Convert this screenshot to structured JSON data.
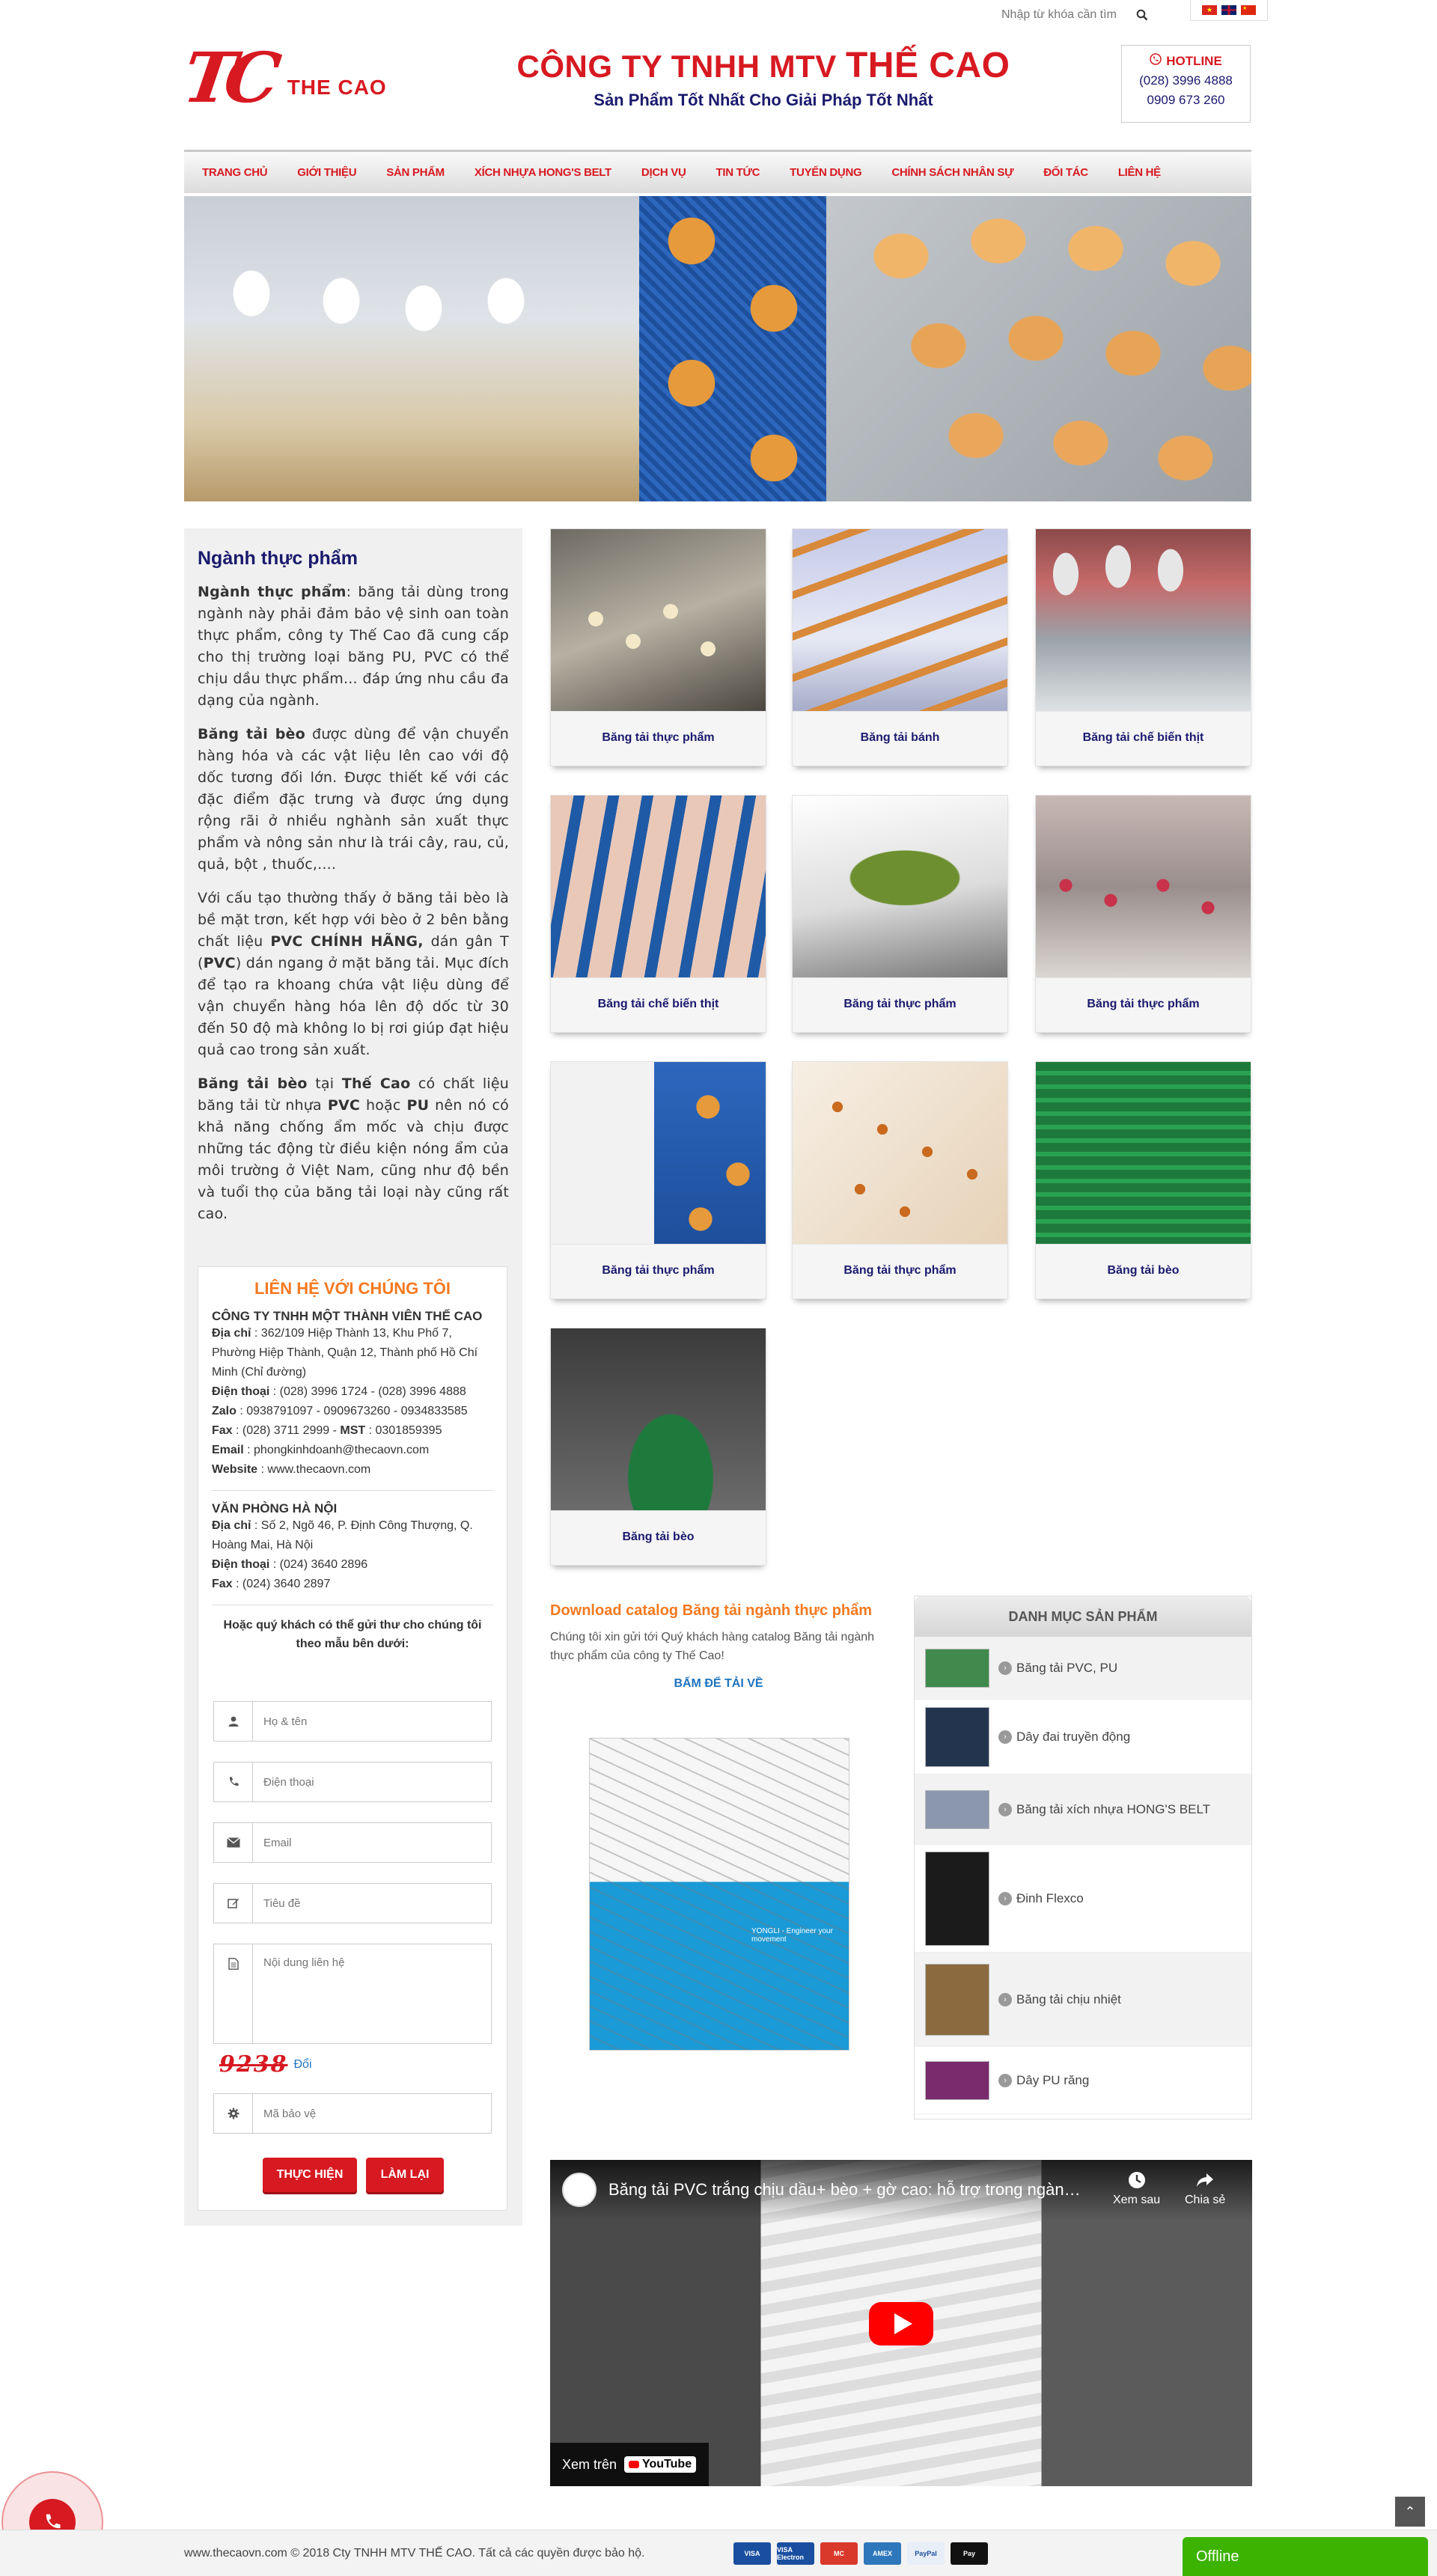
{
  "topbar": {
    "search_placeholder": "Nhập từ khóa cần tìm",
    "languages": [
      "vi",
      "en",
      "zh"
    ]
  },
  "header": {
    "logo_mark": "TC",
    "logo_text": "THE CAO",
    "company_prefix": "CÔNG TY TNHH MTV",
    "company_brand": "THẾ CAO",
    "slogan": "Sản Phẩm Tốt Nhất Cho Giải Pháp Tốt Nhất",
    "hotline_title": "HOTLINE",
    "hotline_1": "(028) 3996 4888",
    "hotline_2": "0909 673 260"
  },
  "nav": {
    "items": [
      "TRANG CHỦ",
      "GIỚI THIỆU",
      "SẢN PHẨM",
      "XÍCH NHỰA HONG'S BELT",
      "DỊCH VỤ",
      "TIN TỨC",
      "TUYỂN DỤNG",
      "CHÍNH SÁCH NHÂN SỰ",
      "ĐỐI TÁC",
      "LIÊN HỆ"
    ]
  },
  "sidebar": {
    "title": "Ngành thực phẩm",
    "p1_bold": "Ngành thực phẩm",
    "p1_rest": ": băng tải dùng trong ngành này phải đảm bảo vệ sinh oan toàn thực phẩm, công ty Thế Cao đã cung cấp cho thị trường loại băng PU, PVC có thể chịu dầu thực phẩm... đáp ứng nhu cầu đa dạng của ngành.",
    "p2_bold": "Băng tải bèo",
    "p2_rest": " được dùng để vận chuyển hàng hóa và các vật liệu lên cao với độ dốc tương đối lớn. Được thiết kế với các đặc điểm đặc trưng và được ứng dụng rộng rãi ở nhiều nghành sản xuất thực phẩm và nông sản như là trái cây, rau, củ, quả, bột , thuốc,....",
    "p3_a": "Với cấu tạo thường thấy ở băng tải bèo là bề mặt trơn, kết hợp với bèo ở 2 bên bằng chất liệu ",
    "p3_b": "PVC CHÍNH HÃNG,",
    "p3_c": " dán gân T (",
    "p3_d": "PVC",
    "p3_e": ") dán ngang ở mặt băng tải. Mục đích để tạo ra khoang chứa vật liệu dùng để vận chuyển hàng hóa lên độ dốc từ 30 đến 50 độ mà không lo bị rơi giúp đạt hiệu quả cao trong sản xuất.",
    "p4_a": "Băng tải bèo",
    "p4_b": " tại ",
    "p4_c": "Thế Cao",
    "p4_d": " có chất liệu băng tải từ nhựa ",
    "p4_e": "PVC",
    "p4_f": " hoặc ",
    "p4_g": "PU",
    "p4_h": " nên nó có khả năng chống ẩm mốc và chịu được những tác động từ điều kiện nóng ẩm của môi trường ở Việt Nam, cũng như độ bền và tuổi thọ của băng tải loại này cũng rất cao."
  },
  "contact": {
    "title": "LIÊN HỆ VỚI CHÚNG TÔI",
    "company": "CÔNG TY TNHH MỘT THÀNH VIÊN THẾ CAO",
    "address_label": "Địa chỉ",
    "address": " : 362/109 Hiệp Thành 13, Khu Phố 7, Phường Hiệp Thành, Quận 12, Thành phố Hồ Chí Minh (Chỉ đường)",
    "phone_label": "Điện thoại",
    "phone": " : (028) 3996 1724  -  (028) 3996 4888",
    "zalo_label": "Zalo",
    "zalo": " : 0938791097 - 0909673260 - 0934833585",
    "fax_label": "Fax",
    "fax": " : (028) 3711 2999  -  ",
    "mst_label": "MST",
    "mst": " : 0301859395",
    "email_label": "Email",
    "email": " : phongkinhdoanh@thecaovn.com",
    "website_label": "Website",
    "website": " : www.thecaovn.com",
    "hanoi_title": "VĂN PHÒNG HÀ NỘI",
    "hanoi_address_label": "Địa chỉ",
    "hanoi_address": " : Số 2, Ngõ 46, P. Định Công Thượng, Q. Hoàng Mai, Hà Nội",
    "hanoi_phone_label": "Điện thoại",
    "hanoi_phone": " : (024) 3640 2896",
    "hanoi_fax_label": "Fax",
    "hanoi_fax": " : (024) 3640 2897",
    "form_intro": "Hoặc quý khách có thể gửi thư cho chúng tôi theo mẫu bên dưới:",
    "name_placeholder": "Họ & tên",
    "phone_placeholder": "Điện thoại",
    "email_placeholder": "Email",
    "subject_placeholder": "Tiêu đề",
    "message_placeholder": "Nội dung liên hệ",
    "captcha_text": "9238",
    "captcha_refresh": "Đổi",
    "captcha_placeholder": "Mã bảo vệ",
    "submit": "THỰC HIỆN",
    "reset": "LÀM LẠI"
  },
  "products": [
    {
      "name": "Băng tải thực phẩm"
    },
    {
      "name": "Băng tải bánh"
    },
    {
      "name": "Băng tải chế biến thịt"
    },
    {
      "name": "Băng tải chế biến thịt"
    },
    {
      "name": "Băng tải thực phẩm"
    },
    {
      "name": "Băng tải thực phẩm"
    },
    {
      "name": "Băng tải thực phẩm"
    },
    {
      "name": "Băng tải thực phẩm"
    },
    {
      "name": "Băng tải bèo"
    },
    {
      "name": "Băng tải bèo"
    }
  ],
  "catalog": {
    "title": "Download catalog Băng tải ngành thực phẩm",
    "desc": "Chúng tôi xin gửi tới Quý khách hàng catalog Băng tải ngành thực phẩm của công ty Thế Cao!",
    "link": "BẤM ĐỂ TẢI VỀ",
    "caption": "YONGLI - Engineer your movement"
  },
  "categories": {
    "title": "DANH MỤC SẢN PHẨM",
    "items": [
      {
        "label": "Băng tải PVC, PU",
        "color": "#3f8a4c"
      },
      {
        "label": "Dây đai truyền động",
        "color": "#23344f"
      },
      {
        "label": "Băng tải xích nhựa HONG'S BELT",
        "color": "#8a97ad"
      },
      {
        "label": "Đinh Flexco",
        "color": "#1b1b1b"
      },
      {
        "label": "Băng tải chịu nhiệt",
        "color": "#8a6a3e"
      },
      {
        "label": "Dây PU răng",
        "color": "#7a2b6e"
      }
    ]
  },
  "video": {
    "title": "Băng tải PVC trắng chịu dầu+ bèo + gờ cao: hỗ trợ trong ngành sả...",
    "watch_later": "Xem sau",
    "share": "Chia sẻ",
    "watch_on": "Xem trên",
    "youtube": "YouTube"
  },
  "footer": {
    "text": "www.thecaovn.com © 2018 Cty TNHH MTV THẾ CAO. Tất cả các quyền được bảo hộ.",
    "payments": [
      {
        "label": "VISA",
        "color": "#1a4fa0"
      },
      {
        "label": "VISA Electron",
        "color": "#1a4fa0"
      },
      {
        "label": "MC",
        "color": "#d8392b"
      },
      {
        "label": "AMEX",
        "color": "#2e77bb"
      },
      {
        "label": "PayPal",
        "color": "#e8eef7"
      },
      {
        "label": "Pay",
        "color": "#111111"
      }
    ],
    "chat": "Offline"
  }
}
